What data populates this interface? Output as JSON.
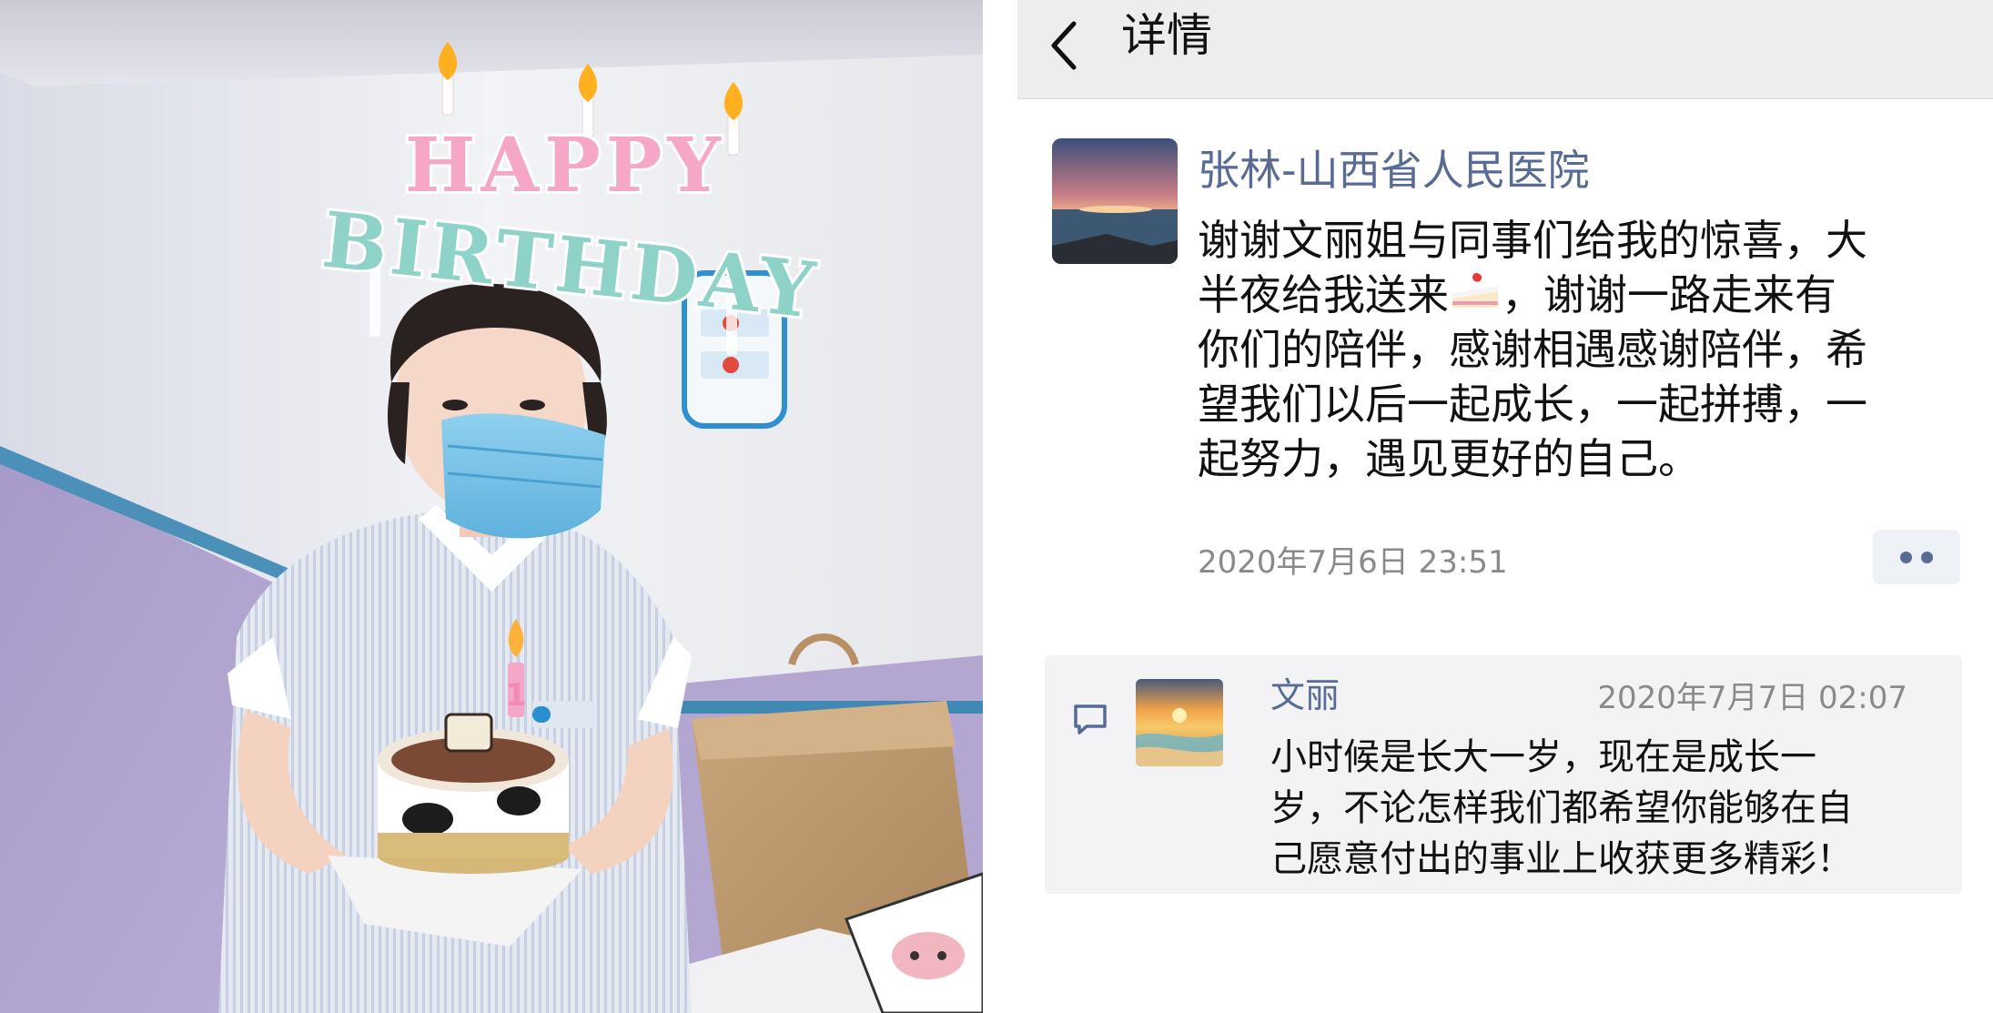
{
  "header": {
    "title": "详情"
  },
  "photo": {
    "sticker_line1": "HAPPY",
    "sticker_line2": "BIRTHDAY",
    "candle_number": "1"
  },
  "post": {
    "author": "张林-山西省人民医院",
    "body_lines": [
      "谢谢文丽姐与同事们给我的惊喜，大",
      "半夜给我送来",
      "，谢谢一路走来有",
      "你们的陪伴，感谢相遇感谢陪伴，希",
      "望我们以后一起成长，一起拼搏，一",
      "起努力，遇见更好的自己。"
    ],
    "emoji": "cake-icon",
    "timestamp": "2020年7月6日 23:51"
  },
  "comment": {
    "author": "文丽",
    "timestamp": "2020年7月7日 02:07",
    "body_lines": [
      "小时候是长大一岁，现在是成长一",
      "岁，不论怎样我们都希望你能够在自",
      "己愿意付出的事业上收获更多精彩！"
    ]
  },
  "colors": {
    "link_blue": "#576b95",
    "topbar_bg": "#ededed",
    "comment_bg": "#f3f3f5"
  }
}
